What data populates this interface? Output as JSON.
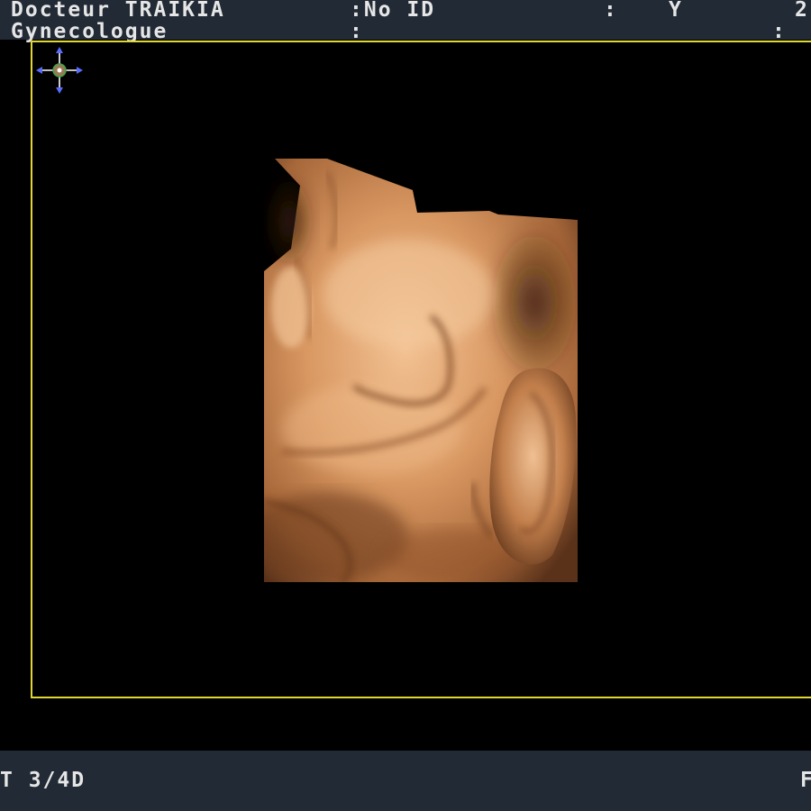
{
  "header": {
    "doctor_name": "Docteur TRAIKIA",
    "specialty": "Gynecologue",
    "id_field": ":No ID",
    "colon_mid": ":",
    "colon_mid2": ":",
    "y_label": "Y",
    "colon_right": ":",
    "right_fragment": "2",
    "row2_colon": ":"
  },
  "footer": {
    "mode_label": "T 3/4D",
    "right_fragment": "F"
  },
  "icons": {
    "cursor": "crosshair-move-icon"
  },
  "colors": {
    "frame": "#e0d830",
    "bar": "#222a36",
    "render_tone": "#c98650"
  }
}
